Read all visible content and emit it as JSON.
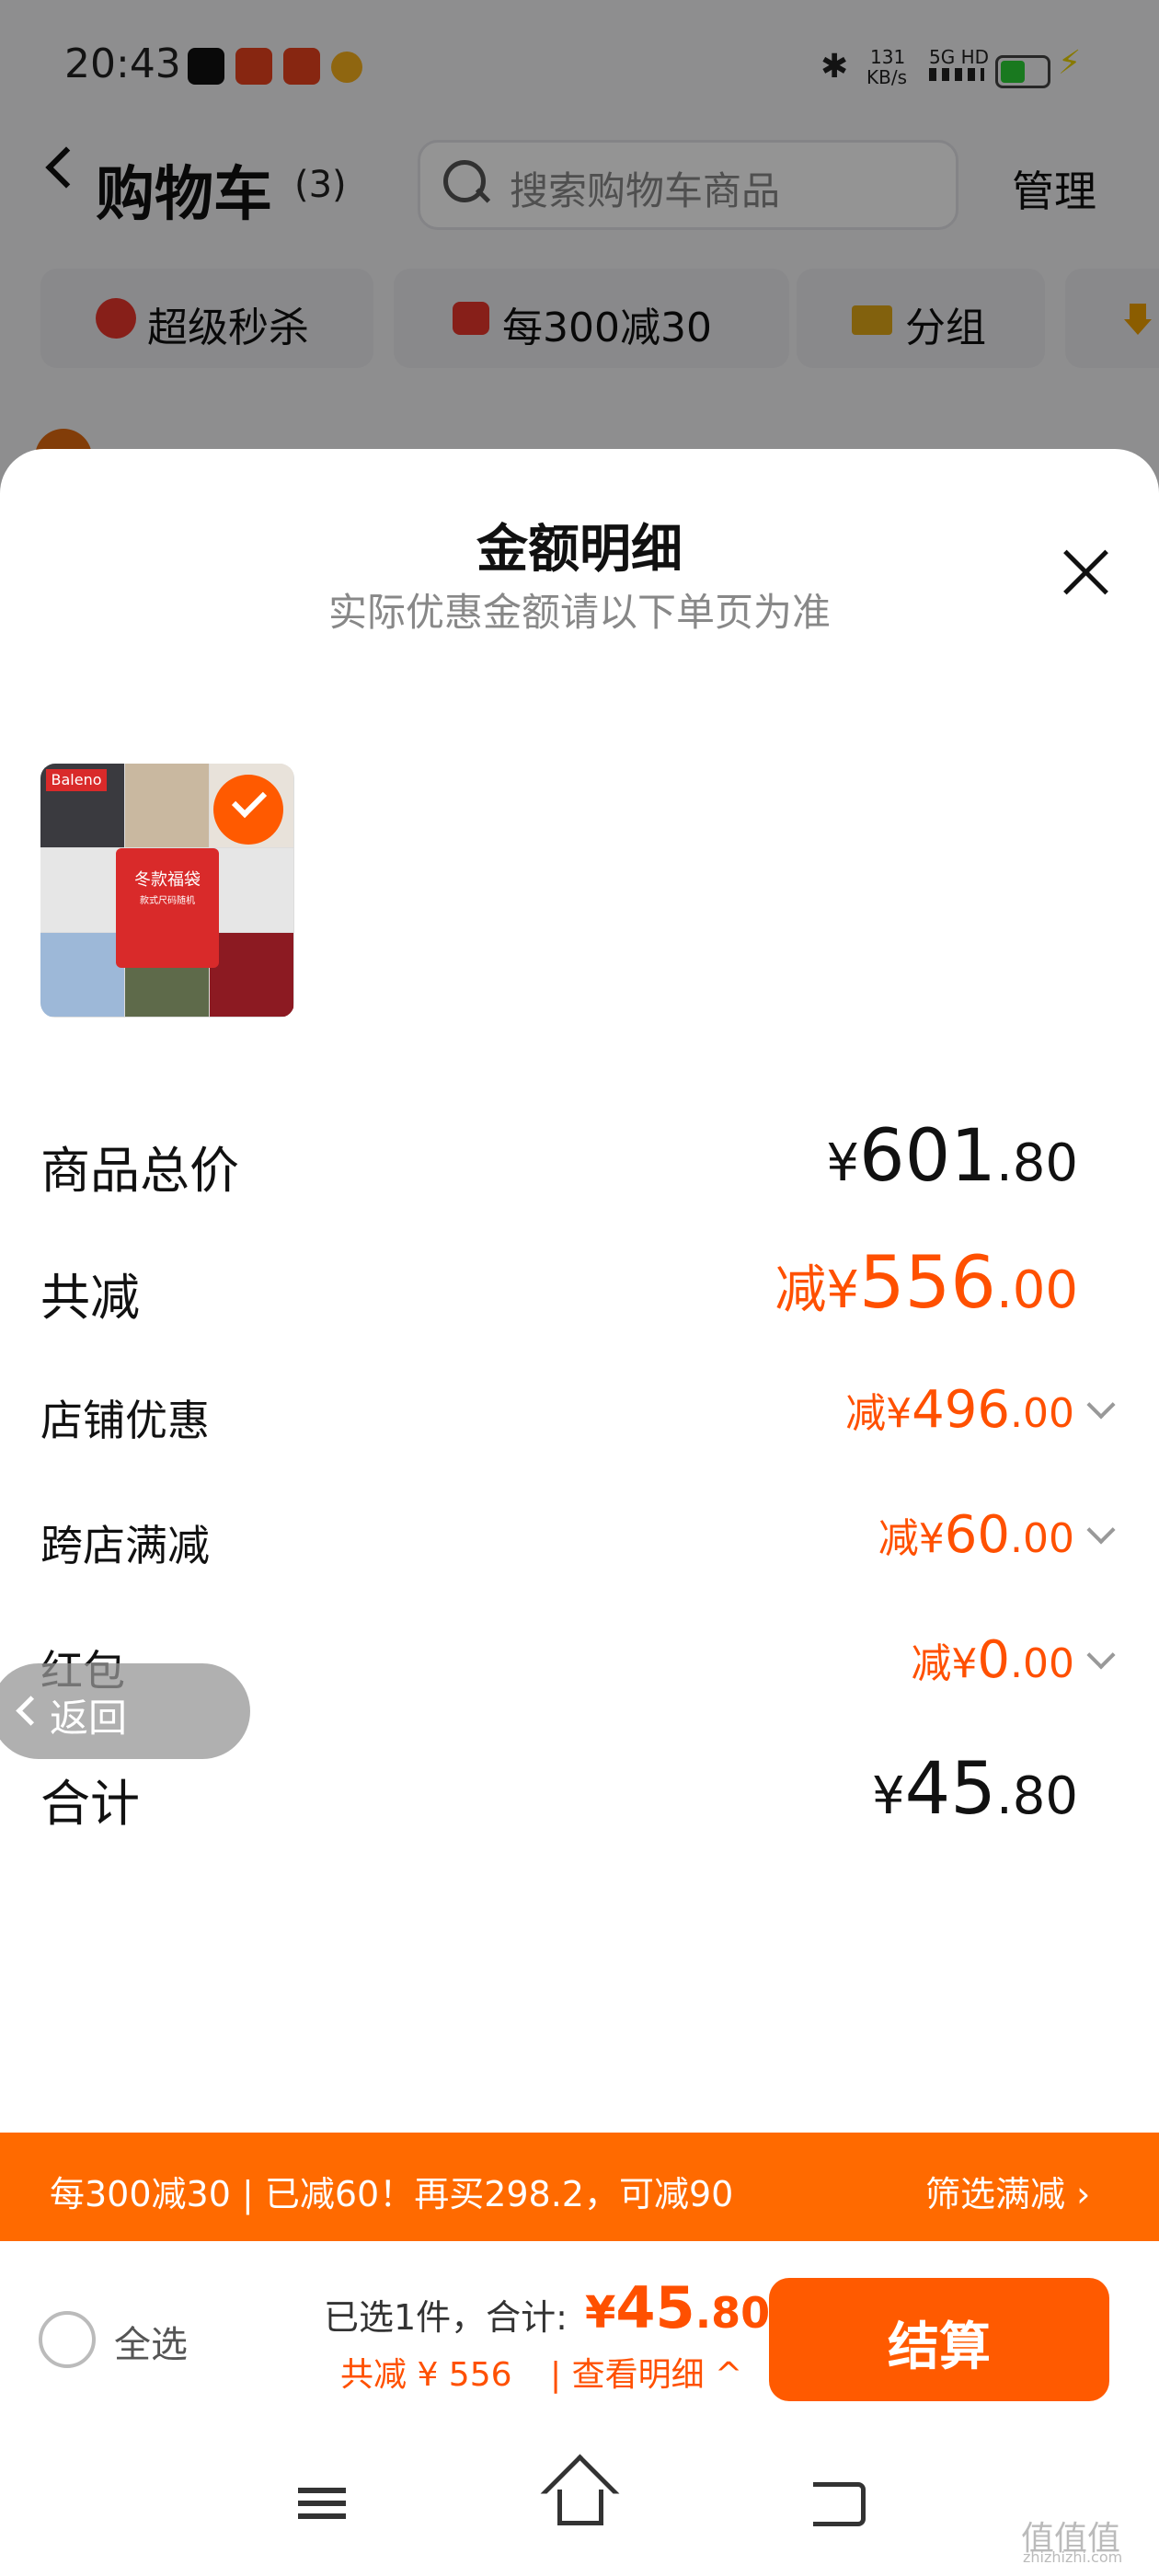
{
  "status_bar": {
    "time": "20:43",
    "net_speed": "131",
    "net_unit": "KB/s",
    "net_type": "5G HD"
  },
  "header": {
    "title": "购物车",
    "count": "(3)",
    "search_placeholder": "搜索购物车商品",
    "manage_label": "管理"
  },
  "chips": [
    {
      "label": "超级秒杀",
      "icon": "lightning-icon"
    },
    {
      "label": "每300减30",
      "icon": "coupon-icon"
    },
    {
      "label": "分组",
      "icon": "folder-icon"
    }
  ],
  "sheet": {
    "title": "金额明细",
    "subtitle": "实际优惠金额请以下单页为准",
    "product": {
      "brand": "Baleno",
      "tag": "冬款福袋",
      "tag_sub": "款式尺码随机"
    },
    "rows": {
      "total": {
        "label": "商品总价",
        "prefix": "¥",
        "int": "601",
        "dec": ".80"
      },
      "discount": {
        "label": "共减",
        "prefix": "减¥",
        "int": "556",
        "dec": ".00"
      },
      "shop": {
        "label": "店铺优惠",
        "prefix": "减¥",
        "int": "496",
        "dec": ".00"
      },
      "cross": {
        "label": "跨店满减",
        "prefix": "减¥",
        "int": "60",
        "dec": ".00"
      },
      "redpacket": {
        "label": "红包",
        "prefix": "减¥",
        "int": "0",
        "dec": ".00"
      },
      "sum": {
        "label": "合计",
        "prefix": "¥",
        "int": "45",
        "dec": ".80"
      }
    }
  },
  "back_pill": {
    "label": "返回"
  },
  "promo": {
    "text": "每300减30 | 已减60！再买298.2，可减90",
    "link": "筛选满减 ›"
  },
  "bottom_bar": {
    "select_all": "全选",
    "selected_info": "已选1件，合计:",
    "price_prefix": "¥",
    "price_int": "45",
    "price_dec": ".80",
    "saved": "共减 ¥ 556",
    "view_detail": "| 查看明细 ^",
    "checkout": "结算"
  },
  "watermark": {
    "text": "值值值",
    "sub": "zhizhizhi.com"
  },
  "colors": {
    "accent": "#ff5000",
    "promo_bg": "#ff6a00",
    "checkout_bg": "#ff5a00"
  }
}
